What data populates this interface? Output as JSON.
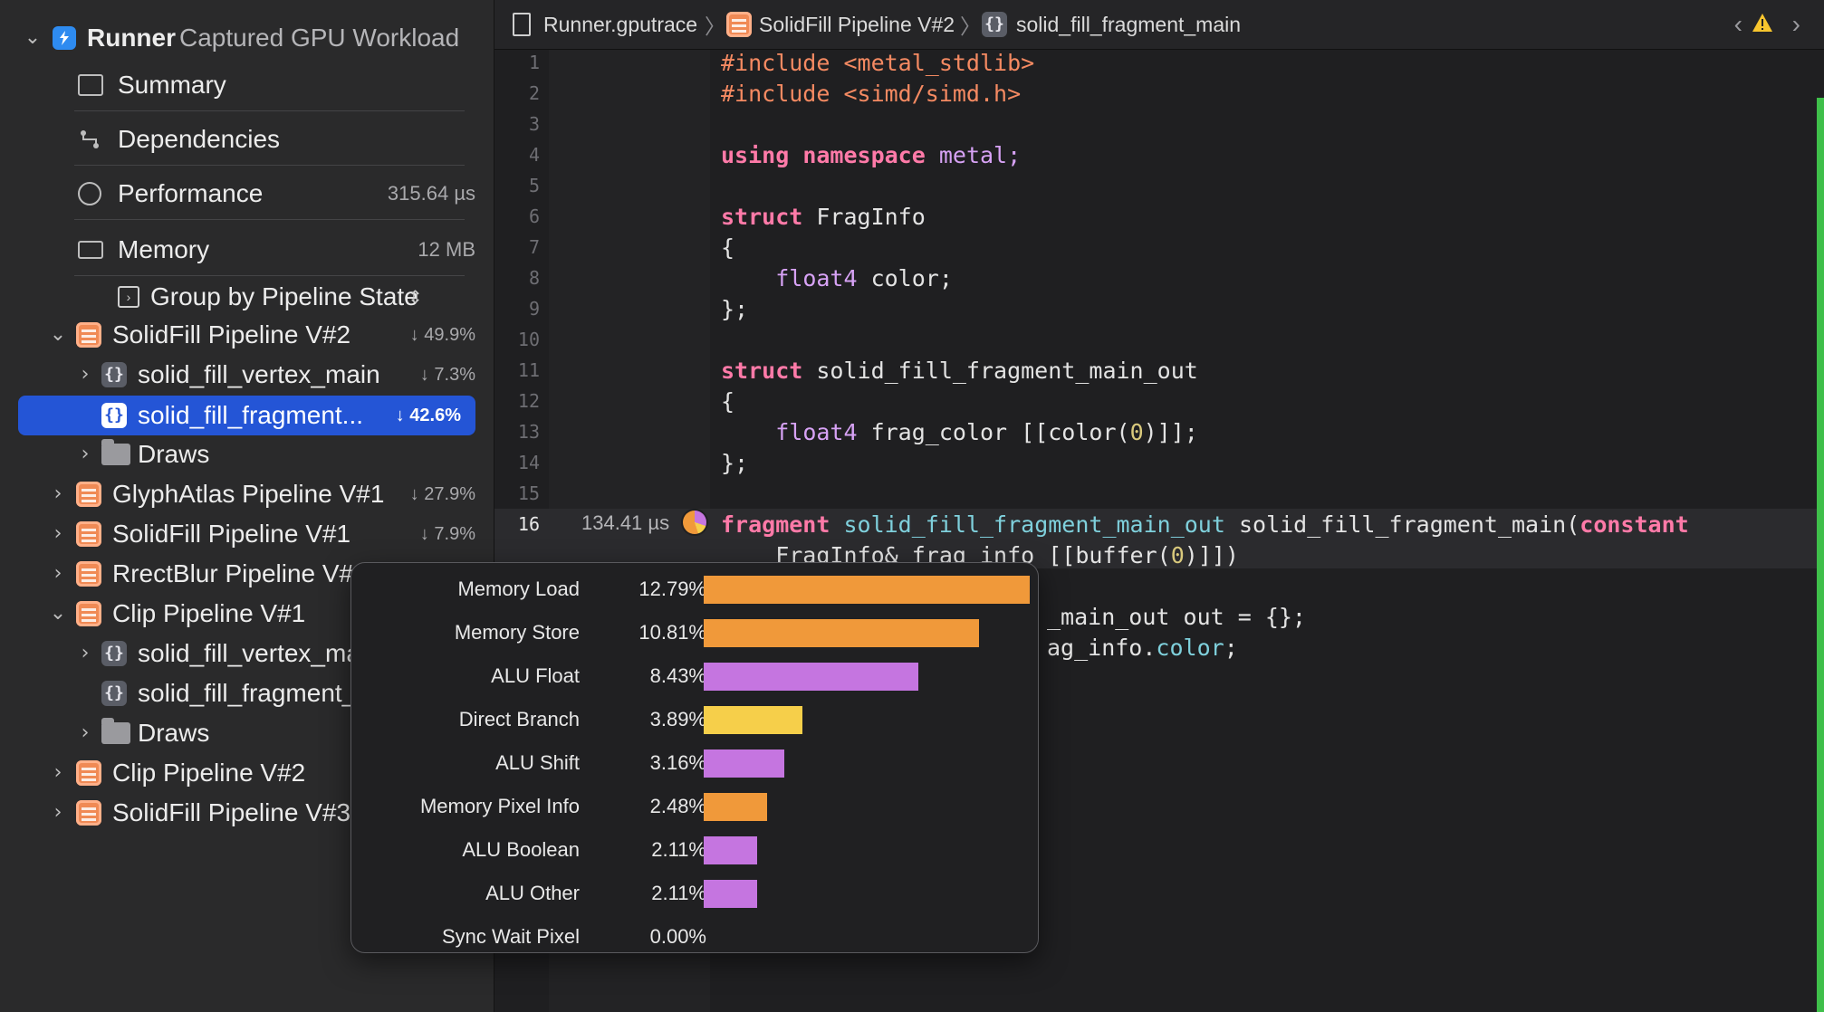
{
  "sidebar": {
    "app_name": "Runner",
    "app_subtitle": "Captured GPU Workload",
    "nav": [
      {
        "label": "Summary",
        "value": ""
      },
      {
        "label": "Dependencies",
        "value": ""
      },
      {
        "label": "Performance",
        "value": "315.64 µs"
      },
      {
        "label": "Memory",
        "value": "12 MB"
      }
    ],
    "group_by": "Group by Pipeline State",
    "tree": [
      {
        "label": "SolidFill Pipeline V#2",
        "pct": "↓ 49.9%"
      },
      {
        "label": "solid_fill_vertex_main",
        "pct": "↓ 7.3%"
      },
      {
        "label": "solid_fill_fragment...",
        "pct": "↓ 42.6%"
      },
      {
        "label": "Draws",
        "pct": ""
      },
      {
        "label": "GlyphAtlas Pipeline V#1",
        "pct": "↓ 27.9%"
      },
      {
        "label": "SolidFill Pipeline V#1",
        "pct": "↓ 7.9%"
      },
      {
        "label": "RrectBlur Pipeline V#1",
        "pct": ""
      },
      {
        "label": "Clip Pipeline V#1",
        "pct": ""
      },
      {
        "label": "solid_fill_vertex_ma",
        "pct": ""
      },
      {
        "label": "solid_fill_fragment_",
        "pct": ""
      },
      {
        "label": "Draws",
        "pct": ""
      },
      {
        "label": "Clip Pipeline V#2",
        "pct": ""
      },
      {
        "label": "SolidFill Pipeline V#3",
        "pct": ""
      }
    ]
  },
  "breadcrumb": {
    "file": "Runner.gputrace",
    "pipeline": "SolidFill Pipeline V#2",
    "function": "solid_fill_fragment_main"
  },
  "editor": {
    "line_numbers": [
      "1",
      "2",
      "3",
      "4",
      "5",
      "6",
      "7",
      "8",
      "9",
      "10",
      "11",
      "12",
      "13",
      "14",
      "15",
      "16"
    ],
    "line16_time": "134.41 µs",
    "code": {
      "l1": "#include <metal_stdlib>",
      "l2": "#include <simd/simd.h>",
      "l4_kw1": "using",
      "l4_kw2": "namespace",
      "l4_rest": " metal;",
      "l6_kw": "struct",
      "l6_rest": " FragInfo",
      "l7": "{",
      "l8_ty": "float4",
      "l8_rest": " color;",
      "l9": "};",
      "l11_kw": "struct",
      "l11_rest": " solid_fill_fragment_main_out",
      "l12": "{",
      "l13_ty": "float4",
      "l13_rest": " frag_color [[color(",
      "l13_num": "0",
      "l13_end": ")]];",
      "l14": "};",
      "l16_kw": "fragment",
      "l16_fn": " solid_fill_fragment_main_out",
      "l16_rest": " solid_fill_fragment_main(",
      "l16_kw2": "constant",
      "l17_a": "    FragInfo& frag_info [[buffer(",
      "l17_num": "0",
      "l17_b": ")]])",
      "l18_visible": "_main_out out = {};",
      "l19_visible": "ag_info.",
      "l19_fn": "color",
      "l19_end": ";"
    }
  },
  "popover": {
    "metrics": [
      {
        "name": "Memory Load",
        "value": "12.79%",
        "pct": 12.79,
        "color": "#f0993a"
      },
      {
        "name": "Memory Store",
        "value": "10.81%",
        "pct": 10.81,
        "color": "#f0993a"
      },
      {
        "name": "ALU Float",
        "value": "8.43%",
        "pct": 8.43,
        "color": "#c575e0"
      },
      {
        "name": "Direct Branch",
        "value": "3.89%",
        "pct": 3.89,
        "color": "#f6cf4a"
      },
      {
        "name": "ALU Shift",
        "value": "3.16%",
        "pct": 3.16,
        "color": "#c575e0"
      },
      {
        "name": "Memory Pixel Info",
        "value": "2.48%",
        "pct": 2.48,
        "color": "#f0993a"
      },
      {
        "name": "ALU Boolean",
        "value": "2.11%",
        "pct": 2.11,
        "color": "#c575e0"
      },
      {
        "name": "ALU Other",
        "value": "2.11%",
        "pct": 2.11,
        "color": "#c575e0"
      },
      {
        "name": "Sync Wait Pixel",
        "value": "0.00%",
        "pct": 0.0,
        "color": "#c575e0"
      }
    ]
  },
  "colors": {
    "selection": "#2455d6",
    "pipeline_icon": "#f08a55",
    "keyword": "#ff7aa8",
    "preprocessor": "#f58a62",
    "type": "#d7a2f5"
  }
}
